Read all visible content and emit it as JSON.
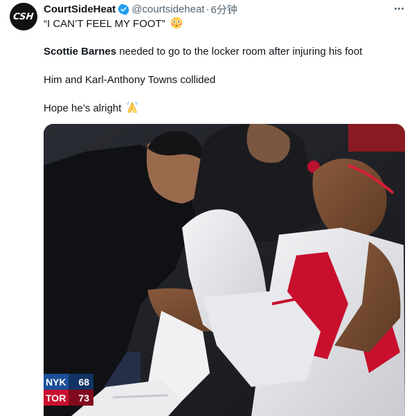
{
  "author": {
    "avatar_text": "CSH",
    "display_name": "CourtSideHeat",
    "handle": "@courtsideheat",
    "separator": "·",
    "time": "6分钟",
    "verified_icon": "verified-badge-icon"
  },
  "tweet": {
    "line1": "“I CAN’T FEEL MY FOOT”",
    "line1_emoji": "flushed-face-emoji",
    "line2_name": "Scottie Barnes",
    "line2_rest": " needed to go to the locker room after injuring his foot",
    "line3": "Him and Karl-Anthony Towns collided",
    "line4": "Hope he’s alright",
    "line4_emoji": "folded-hands-emoji"
  },
  "media": {
    "scoreboard": {
      "teams": [
        {
          "abbr": "NYK",
          "score": "68",
          "color": "#1d4f9a"
        },
        {
          "abbr": "TOR",
          "score": "73",
          "color": "#c8102e"
        }
      ]
    }
  },
  "colors": {
    "text": "#0f1419",
    "secondary": "#536471",
    "verified": "#1d9bf0",
    "raptors_red": "#c8102e"
  }
}
